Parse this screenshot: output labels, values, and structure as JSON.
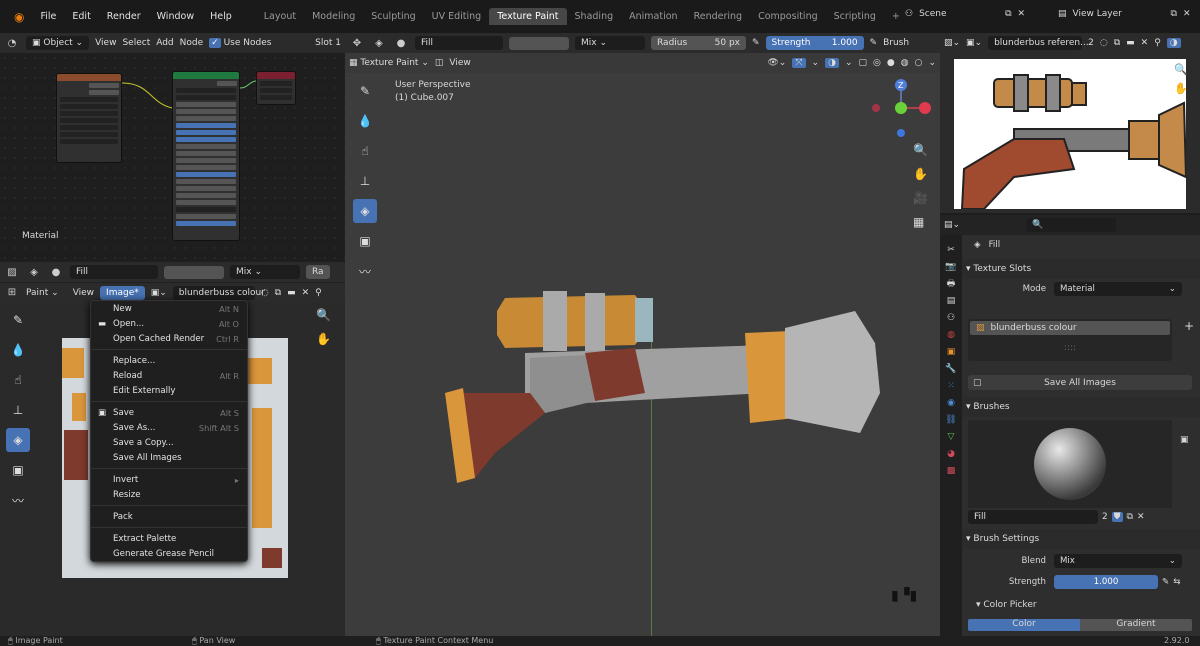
{
  "topbar": {
    "menus": [
      "File",
      "Edit",
      "Render",
      "Window",
      "Help"
    ],
    "workspaces": [
      "Layout",
      "Modeling",
      "Sculpting",
      "UV Editing",
      "Texture Paint",
      "Shading",
      "Animation",
      "Rendering",
      "Compositing",
      "Scripting"
    ],
    "active_workspace": "Texture Paint",
    "add_tab": "+",
    "scene": "Scene",
    "view_layer": "View Layer"
  },
  "node_editor": {
    "mode": "Object",
    "menus": [
      "View",
      "Select",
      "Add",
      "Node"
    ],
    "use_nodes_label": "Use Nodes",
    "slot": "Slot 1",
    "material_label": "Material"
  },
  "image_editor": {
    "brush_name": "Fill",
    "blend": "Mix",
    "blend_cut": "Ra",
    "mode": "Paint",
    "menus": [
      "View",
      "Image*"
    ],
    "image_name": "blunderbuss colour"
  },
  "context_menu": {
    "items": [
      {
        "label": "New",
        "shortcut": "Alt N"
      },
      {
        "label": "Open...",
        "shortcut": "Alt O"
      },
      {
        "label": "Open Cached Render",
        "shortcut": "Ctrl R"
      },
      {
        "sep": true
      },
      {
        "label": "Replace...",
        "shortcut": ""
      },
      {
        "label": "Reload",
        "shortcut": "Alt R"
      },
      {
        "label": "Edit Externally",
        "shortcut": ""
      },
      {
        "sep": true
      },
      {
        "label": "Save",
        "shortcut": "Alt S"
      },
      {
        "label": "Save As...",
        "shortcut": "Shift Alt S"
      },
      {
        "label": "Save a Copy...",
        "shortcut": ""
      },
      {
        "label": "Save All Images",
        "shortcut": ""
      },
      {
        "sep": true
      },
      {
        "label": "Invert",
        "shortcut": "▸"
      },
      {
        "label": "Resize",
        "shortcut": ""
      },
      {
        "sep": true
      },
      {
        "label": "Pack",
        "shortcut": ""
      },
      {
        "sep": true
      },
      {
        "label": "Extract Palette",
        "shortcut": ""
      },
      {
        "label": "Generate Grease Pencil",
        "shortcut": ""
      }
    ]
  },
  "viewport": {
    "brush_name": "Fill",
    "blend": "Mix",
    "radius_label": "Radius",
    "radius_value": "50 px",
    "strength_label": "Strength",
    "strength_value": "1.000",
    "brush_menu": "Brush",
    "mode": "Texture Paint",
    "view_menu": "View",
    "perspective": "User Perspective",
    "object": "(1) Cube.007",
    "gizmo_z": "Z"
  },
  "ref_image": {
    "name": "blunderbus referen...",
    "users": "2"
  },
  "properties": {
    "active_tool": "Fill",
    "texture_slots_title": "Texture Slots",
    "mode_label": "Mode",
    "mode_value": "Material",
    "slot_name": "blunderbuss colour",
    "save_all": "Save All Images",
    "brushes_title": "Brushes",
    "brush_name": "Fill",
    "brush_users": "2",
    "brush_settings_title": "Brush Settings",
    "blend_label": "Blend",
    "blend_value": "Mix",
    "strength_label": "Strength",
    "strength_value": "1.000",
    "color_picker_title": "Color Picker",
    "color_tab": "Color",
    "gradient_tab": "Gradient",
    "add_slot": "+",
    "list_dots": "::::"
  },
  "statusbar": {
    "left": "Image Paint",
    "mid": "Pan View",
    "right": "Texture Paint Context Menu",
    "version": "2.92.0"
  },
  "colors": {
    "accent": "#4772b3",
    "orange": "#d9963a",
    "wood": "#7e3a2c",
    "metal": "#a8a8a8"
  }
}
